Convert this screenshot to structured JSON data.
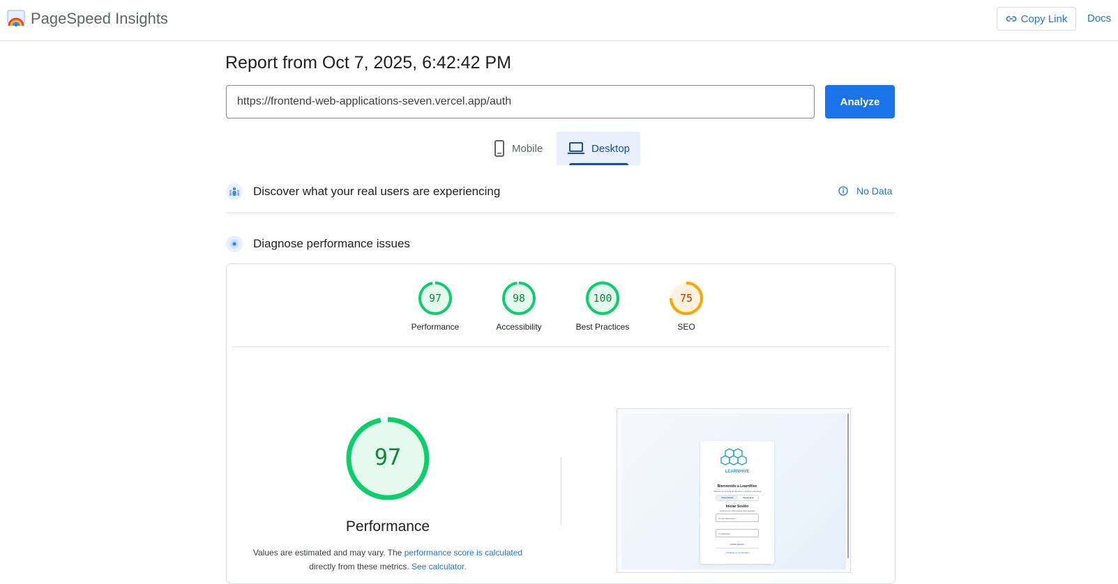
{
  "header": {
    "brand": "PageSpeed Insights",
    "copy_link": "Copy Link",
    "docs": "Docs"
  },
  "report": {
    "title": "Report from Oct 7, 2025, 6:42:42 PM",
    "url": "https://frontend-web-applications-seven.vercel.app/auth",
    "analyze": "Analyze"
  },
  "tabs": [
    {
      "label": "Mobile",
      "icon": "phone-icon",
      "selected": false
    },
    {
      "label": "Desktop",
      "icon": "laptop-icon",
      "selected": true
    }
  ],
  "field_data": {
    "title": "Discover what your real users are experiencing",
    "status": "No Data"
  },
  "lab": {
    "title": "Diagnose performance issues",
    "scores": [
      {
        "label": "Performance",
        "score": 97,
        "color": "#0cce6b"
      },
      {
        "label": "Accessibility",
        "score": 98,
        "color": "#0cce6b"
      },
      {
        "label": "Best Practices",
        "score": 100,
        "color": "#0cce6b"
      },
      {
        "label": "SEO",
        "score": 75,
        "color": "#ffa400"
      }
    ],
    "main": {
      "score": 97,
      "label": "Performance",
      "disclaimer_1": "Values are estimated and may vary. The",
      "disclaimer_link1": "performance score is calculated",
      "disclaimer_2": "directly from these metrics.",
      "disclaimer_link2": "See calculator."
    },
    "screenshot": {
      "brand": "LEARNHIVE",
      "welcome": "Bienvenido a LearnHive",
      "subtitle": "Plataforma integral de alumnos y gestión educativa",
      "tab_login": "Iniciar Sesión",
      "tab_register": "Registrarse",
      "form_title": "Iniciar Sesión",
      "form_subtitle": "Ingresa tus credenciales para acceder",
      "email_placeholder": "Correo electrónico *",
      "password_placeholder": "Contraseña *",
      "submit": "Iniciar Sesión",
      "forgot": "¿Olvidaste tu contraseña?"
    }
  },
  "colors": {
    "accent": "#1a73e8",
    "pass": "#0cce6b",
    "average": "#ffa400"
  }
}
